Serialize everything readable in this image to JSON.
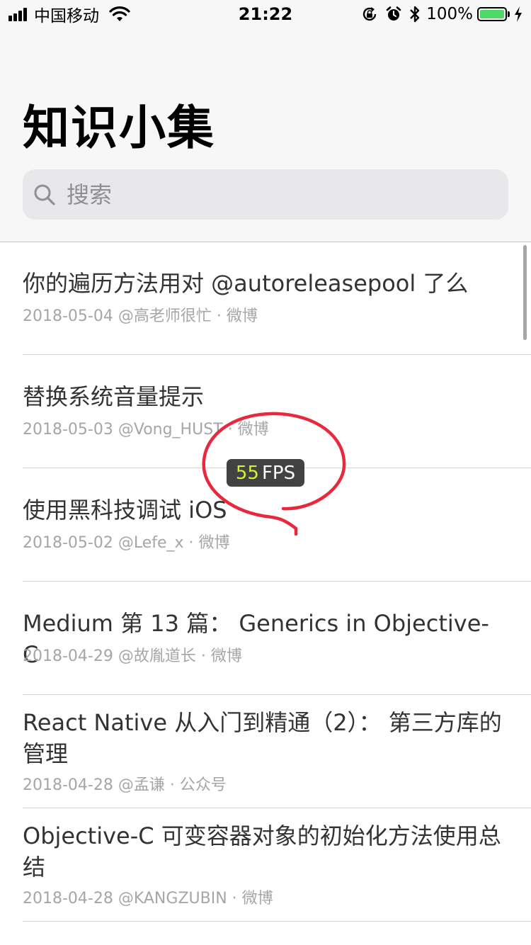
{
  "status_bar": {
    "carrier": "中国移动",
    "time": "21:22",
    "battery_percent": "100%",
    "battery_level": 1.0,
    "battery_color": "#4cd964"
  },
  "header": {
    "title": "知识小集"
  },
  "search": {
    "placeholder": "搜索",
    "value": ""
  },
  "articles": [
    {
      "title": "你的遍历方法用对 @autoreleasepool 了么",
      "meta": "2018-05-04 @高老师很忙 · 微博"
    },
    {
      "title": "替换系统音量提示",
      "meta": "2018-05-03 @Vong_HUST · 微博"
    },
    {
      "title": "使用黑科技调试 iOS",
      "meta": "2018-05-02 @Lefe_x · 微博"
    },
    {
      "title": "Medium 第 13 篇： Generics in Objective-C",
      "meta": "2018-04-29 @故胤道长 · 微博"
    },
    {
      "title": "React Native 从入门到精通（2）： 第三方库的管理",
      "meta": "2018-04-28 @孟谦 · 公众号"
    },
    {
      "title": "Objective-C 可变容器对象的初始化方法使用总结",
      "meta": "2018-04-28 @KANGZUBIN · 微博"
    }
  ],
  "fps_overlay": {
    "value": "55",
    "unit": "FPS",
    "value_color": "#d7ef3a",
    "annotation_color": "#e8283c"
  },
  "icons": {
    "signal": "signal-bars-icon",
    "wifi": "wifi-icon",
    "orientation_lock": "orientation-lock-icon",
    "alarm": "alarm-icon",
    "bluetooth": "bluetooth-icon",
    "charging": "charging-bolt-icon",
    "search": "search-icon"
  }
}
